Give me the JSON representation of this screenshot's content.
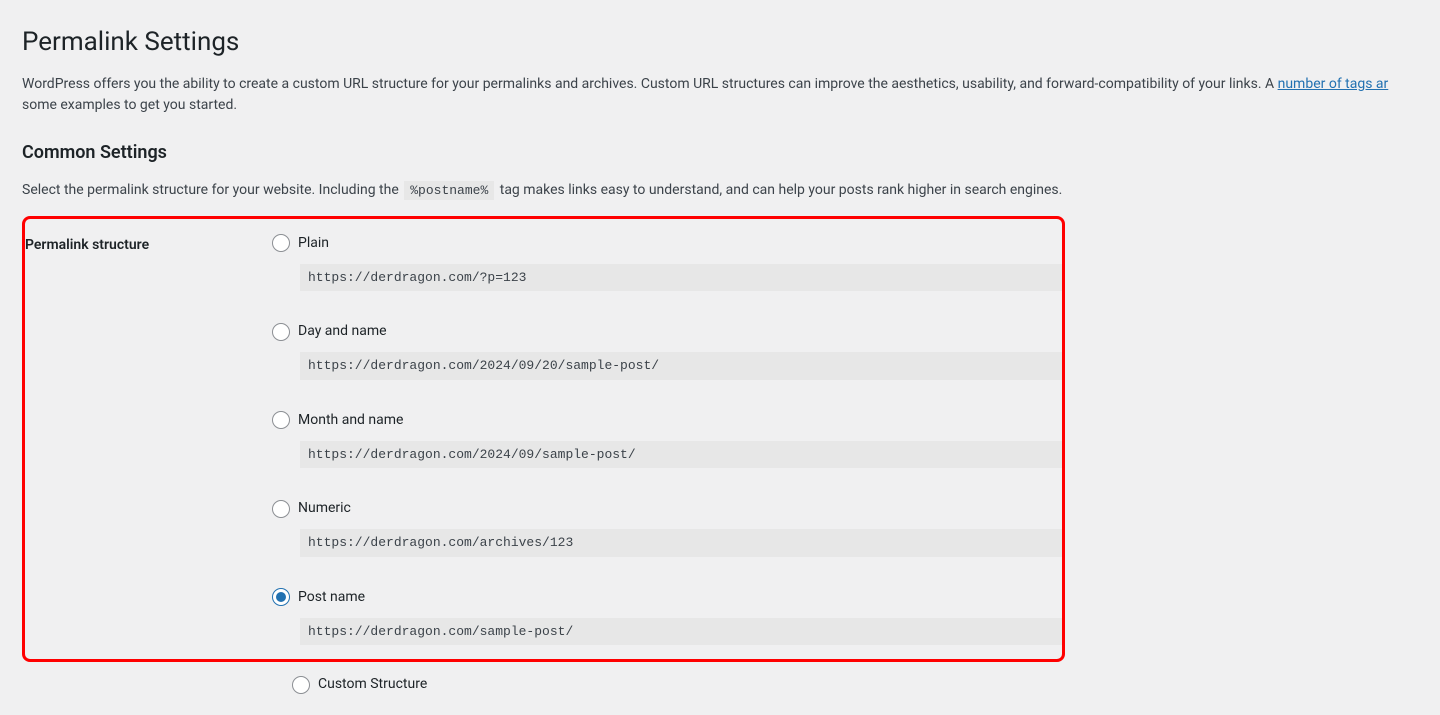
{
  "page": {
    "title": "Permalink Settings",
    "intro_before_link": "WordPress offers you the ability to create a custom URL structure for your permalinks and archives. Custom URL structures can improve the aesthetics, usability, and forward-compatibility of your links. A ",
    "intro_link_text": "number of tags ar",
    "intro_after_link": " some examples to get you started."
  },
  "common": {
    "heading": "Common Settings",
    "intro_before_code": "Select the permalink structure for your website. Including the ",
    "code_tag": "%postname%",
    "intro_after_code": " tag makes links easy to understand, and can help your posts rank higher in search engines."
  },
  "structure": {
    "label": "Permalink structure",
    "selected": "post_name",
    "options": [
      {
        "id": "plain",
        "label": "Plain",
        "example": "https://derdragon.com/?p=123"
      },
      {
        "id": "day_name",
        "label": "Day and name",
        "example": "https://derdragon.com/2024/09/20/sample-post/"
      },
      {
        "id": "month_name",
        "label": "Month and name",
        "example": "https://derdragon.com/2024/09/sample-post/"
      },
      {
        "id": "numeric",
        "label": "Numeric",
        "example": "https://derdragon.com/archives/123"
      },
      {
        "id": "post_name",
        "label": "Post name",
        "example": "https://derdragon.com/sample-post/"
      },
      {
        "id": "custom",
        "label": "Custom Structure",
        "example": ""
      }
    ]
  }
}
